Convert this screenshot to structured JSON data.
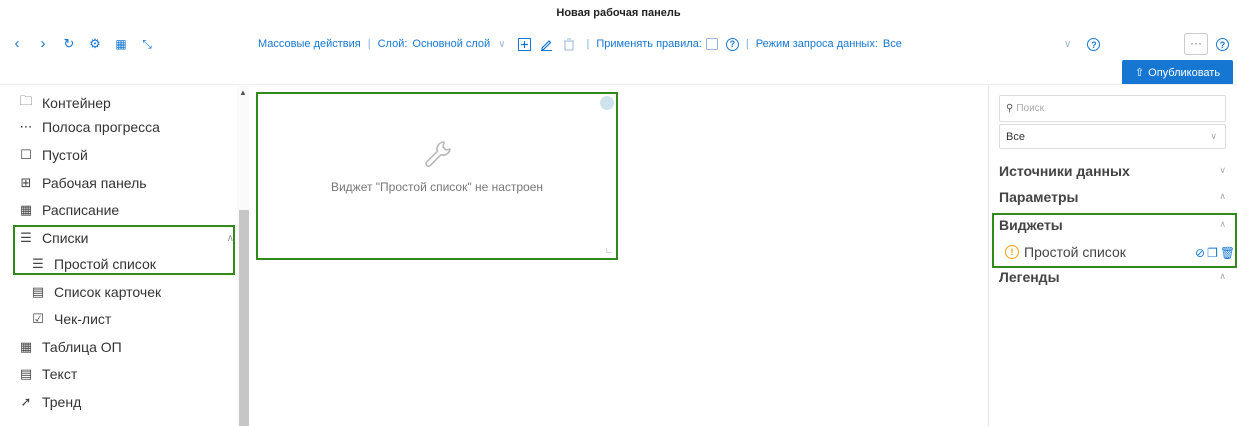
{
  "window": {
    "title": "Новая рабочая панель"
  },
  "toolbar": {
    "nav_icons": [
      "chevron-left-icon",
      "chevron-right-icon",
      "refresh-icon",
      "gear-icon",
      "dashboard-icon",
      "fullscreen-icon"
    ],
    "bulk_actions": "Массовые действия",
    "layer_label": "Слой:",
    "layer_value": "Основной слой",
    "apply_rules_label": "Применять правила:",
    "data_mode_label": "Режим запроса данных:",
    "data_mode_value": "Все",
    "more_label": "···"
  },
  "publish": {
    "label": "Опубликовать"
  },
  "left_panel": {
    "items": [
      {
        "label": "Контейнер",
        "icon": "folder-icon"
      },
      {
        "label": "Полоса прогресса",
        "icon": "progress-dots-icon"
      },
      {
        "label": "Пустой",
        "icon": "square-icon"
      },
      {
        "label": "Рабочая панель",
        "icon": "grid-icon"
      },
      {
        "label": "Расписание",
        "icon": "calendar-icon"
      },
      {
        "label": "Списки",
        "icon": "list-icon",
        "expanded": true
      },
      {
        "label": "Простой список",
        "icon": "list-icon"
      },
      {
        "label": "Список карточек",
        "icon": "cards-icon"
      },
      {
        "label": "Чек-лист",
        "icon": "checkbox-icon"
      },
      {
        "label": "Таблица ОП",
        "icon": "table-icon"
      },
      {
        "label": "Текст",
        "icon": "text-icon"
      },
      {
        "label": "Тренд",
        "icon": "trend-icon"
      }
    ]
  },
  "canvas": {
    "widget_message": "Виджет \"Простой список\" не настроен"
  },
  "right_panel": {
    "search_placeholder": "Поиск",
    "filter_value": "Все",
    "sections": {
      "data_sources": "Источники данных",
      "parameters": "Параметры",
      "widgets": "Виджеты",
      "legends": "Легенды"
    },
    "widget_item": "Простой список"
  },
  "colors": {
    "accent": "#1677d2",
    "highlight": "#2f8a1a",
    "warning": "#f0a500"
  }
}
